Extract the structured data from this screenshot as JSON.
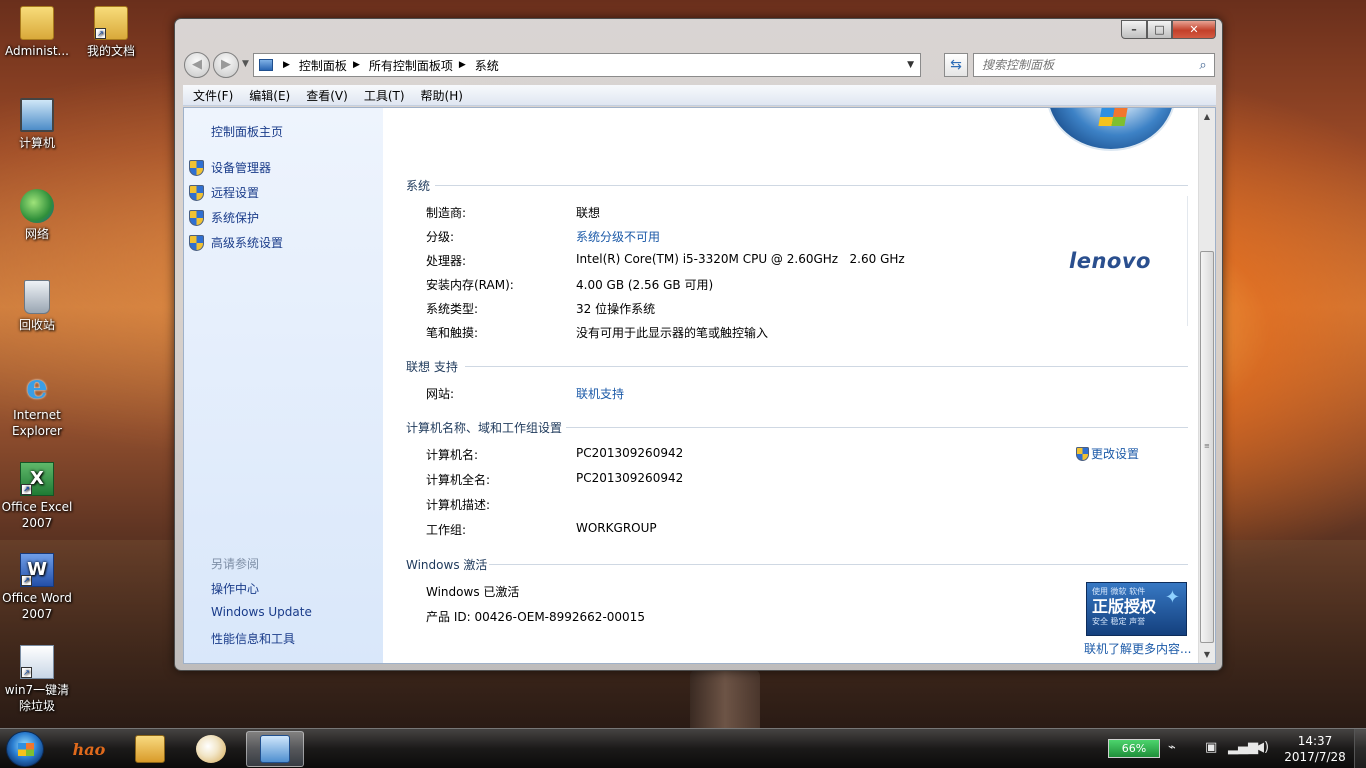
{
  "desktop": {
    "icons": [
      {
        "label": "Administ...",
        "icon": "user-folder-icon"
      },
      {
        "label": "我的文档",
        "icon": "documents-icon"
      },
      {
        "label": "计算机",
        "icon": "computer-icon"
      },
      {
        "label": "网络",
        "icon": "network-icon"
      },
      {
        "label": "回收站",
        "icon": "recycle-bin-icon"
      },
      {
        "label_line1": "Internet",
        "label_line2": "Explorer",
        "icon": "ie-icon"
      },
      {
        "label_line1": "Office Excel",
        "label_line2": "2007",
        "icon": "excel-icon"
      },
      {
        "label_line1": "Office Word",
        "label_line2": "2007",
        "icon": "word-icon"
      },
      {
        "label_line1": "win7一键清",
        "label_line2": "除垃圾",
        "icon": "cleaner-icon"
      }
    ]
  },
  "window": {
    "caption": {
      "minimize": "–",
      "maximize": "□",
      "close": "✕"
    },
    "nav": {
      "back": "◀",
      "forward": "▶",
      "history": "▼"
    },
    "address": {
      "crumbs": [
        "控制面板",
        "所有控制面板项",
        "系统"
      ],
      "separator": "▶",
      "dropdown": "▼"
    },
    "refresh_glyph": "⇆",
    "search": {
      "placeholder": "搜索控制面板",
      "glyph": "⌕"
    },
    "menu": [
      "文件(F)",
      "编辑(E)",
      "查看(V)",
      "工具(T)",
      "帮助(H)"
    ],
    "sidebar": {
      "home": "控制面板主页",
      "links": [
        "设备管理器",
        "远程设置",
        "系统保护",
        "高级系统设置"
      ],
      "see_also_title": "另请参阅",
      "see_also": [
        "操作中心",
        "Windows Update",
        "性能信息和工具"
      ]
    },
    "system": {
      "section_title": "系统",
      "rows": [
        {
          "label": "制造商:",
          "value": "联想",
          "is_link": false
        },
        {
          "label": "分级:",
          "value": "系统分级不可用",
          "is_link": true
        },
        {
          "label": "处理器:",
          "value": "Intel(R) Core(TM) i5-3320M CPU @ 2.60GHz   2.60 GHz",
          "is_link": false
        },
        {
          "label": "安装内存(RAM):",
          "value": "4.00 GB (2.56 GB 可用)",
          "is_link": false
        },
        {
          "label": "系统类型:",
          "value": "32 位操作系统",
          "is_link": false
        },
        {
          "label": "笔和触摸:",
          "value": "没有可用于此显示器的笔或触控输入",
          "is_link": false
        }
      ],
      "oem_logo": "lenovo"
    },
    "support": {
      "section_title": "联想 支持",
      "rows": [
        {
          "label": "网站:",
          "value": "联机支持",
          "is_link": true
        }
      ]
    },
    "computer_name": {
      "section_title": "计算机名称、域和工作组设置",
      "change_settings": "更改设置",
      "rows": [
        {
          "label": "计算机名:",
          "value": "PC201309260942"
        },
        {
          "label": "计算机全名:",
          "value": "PC201309260942"
        },
        {
          "label": "计算机描述:",
          "value": ""
        },
        {
          "label": "工作组:",
          "value": "WORKGROUP"
        }
      ]
    },
    "activation": {
      "section_title": "Windows 激活",
      "status": "Windows 已激活",
      "product_id": "产品 ID: 00426-OEM-8992662-00015",
      "badge_top": "使用 微软 软件",
      "badge_main": "正版授权",
      "badge_sub": "安全 稳定 声誉",
      "learn_more": "联机了解更多内容..."
    },
    "scrollbar": {
      "up": "▲",
      "down": "▼",
      "grip": "≡"
    }
  },
  "taskbar": {
    "pinned": [
      {
        "name": "hao",
        "label": "hao"
      },
      {
        "name": "explorer"
      },
      {
        "name": "paint"
      },
      {
        "name": "control-panel",
        "active": true
      }
    ],
    "battery": "66%",
    "time": "14:37",
    "date": "2017/7/28"
  }
}
